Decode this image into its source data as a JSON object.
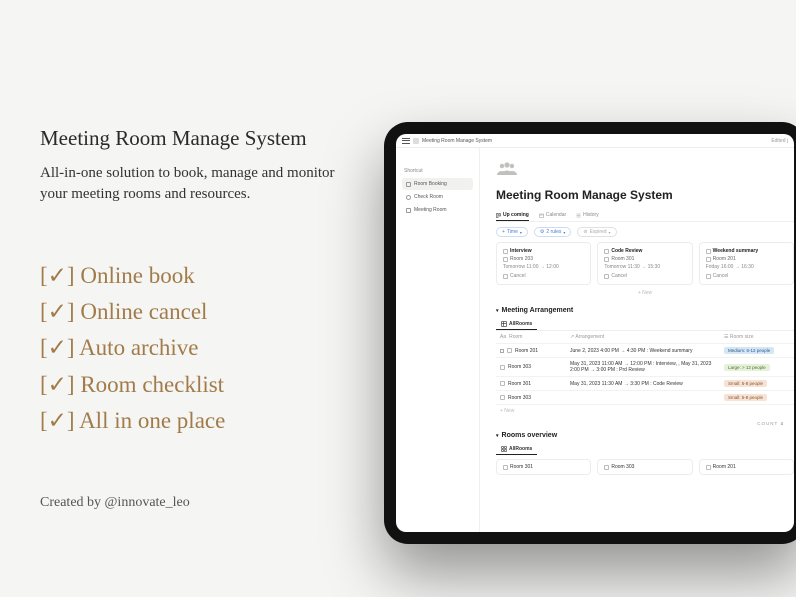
{
  "left": {
    "title": "Meeting Room Manage System",
    "subtitle": "All-in-one solution to book, manage and monitor your meeting rooms and resources.",
    "features": [
      "[✓] Online book",
      "[✓] Online cancel",
      "[✓] Auto archive",
      "[✓] Room checklist",
      "[✓] All in one place"
    ],
    "credit": "Created by @innovate_leo"
  },
  "app": {
    "topbar": {
      "title": "Meeting Room Manage System",
      "right": "Edited j"
    },
    "sidebar": {
      "label": "Shortcut",
      "items": [
        {
          "label": "Room Booking"
        },
        {
          "label": "Check Room"
        },
        {
          "label": "Meeting Room"
        }
      ]
    },
    "main_title": "Meeting Room Manage System",
    "tabs": [
      {
        "label": "Up coming",
        "active": true
      },
      {
        "label": "Calendar"
      },
      {
        "label": "History"
      }
    ],
    "filters": {
      "time": "Time",
      "rules": "2 rules",
      "expired": "Expired"
    },
    "cards": [
      {
        "title": "Interview",
        "room": "Room 203",
        "time": "Tomorrow 11:00 → 12:00",
        "cancel": "Cancel"
      },
      {
        "title": "Code Review",
        "room": "Room 301",
        "time": "Tomorrow 11:30 → 15:30",
        "cancel": "Cancel"
      },
      {
        "title": "Weekend summary",
        "room": "Room 201",
        "time": "Friday 16:00 → 16:30",
        "cancel": "Cancel"
      }
    ],
    "addnew": "+  New",
    "arrangement": {
      "heading": "Meeting Arrangement",
      "tab": "AllRooms",
      "columns": {
        "room": "Room",
        "arr": "Arrangement",
        "size": "Room size"
      },
      "rows": [
        {
          "room": "Room 201",
          "arr": "June 2, 2023 4:00 PM → 4:30 PM : Weekend summary",
          "size": "Medium: 6-12 people",
          "size_cls": "med"
        },
        {
          "room": "Room 303",
          "arr": "May 31, 2023 11:00 AM → 12:00 PM : Interview, , May 31, 2023 2:00 PM → 3:00 PM : Prd Review",
          "size": "Large: > 12 people",
          "size_cls": "lg"
        },
        {
          "room": "Room 301",
          "arr": "May 31, 2023 11:30 AM → 3:30 PM : Code Review",
          "size": "Small: 5-8 people",
          "size_cls": "sm"
        },
        {
          "room": "Room 303",
          "arr": "",
          "size": "Small: 5-8 people",
          "size_cls": "sm"
        }
      ],
      "count_label": "COUNT",
      "count_value": "4",
      "new": "+  New"
    },
    "overview": {
      "heading": "Rooms overview",
      "tab": "AllRooms",
      "cards": [
        {
          "label": "Room 301"
        },
        {
          "label": "Room 303"
        },
        {
          "label": "Room 201"
        }
      ]
    }
  }
}
